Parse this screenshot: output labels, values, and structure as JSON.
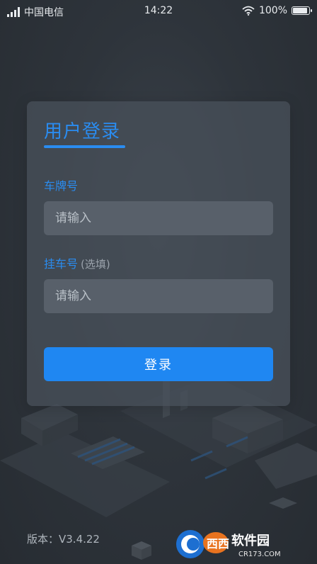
{
  "status_bar": {
    "carrier": "中国电信",
    "time": "14:22",
    "battery": "100%",
    "battery_level": 1.0,
    "signal_icon": "signal-icon",
    "wifi_icon": "wifi-icon"
  },
  "login": {
    "title": "用户登录",
    "plate_label": "车牌号",
    "plate_placeholder": "请输入",
    "trailer_label": "挂车号",
    "trailer_optional": "(选填)",
    "trailer_placeholder": "请输入",
    "submit_label": "登录"
  },
  "footer": {
    "version": "版本：V3.4.22"
  },
  "watermark": {
    "brand": "西西软件园",
    "url": "CR173.COM"
  },
  "colors": {
    "accent": "#2a8cf0",
    "button": "#1f87f2",
    "background": "#2e343b"
  }
}
